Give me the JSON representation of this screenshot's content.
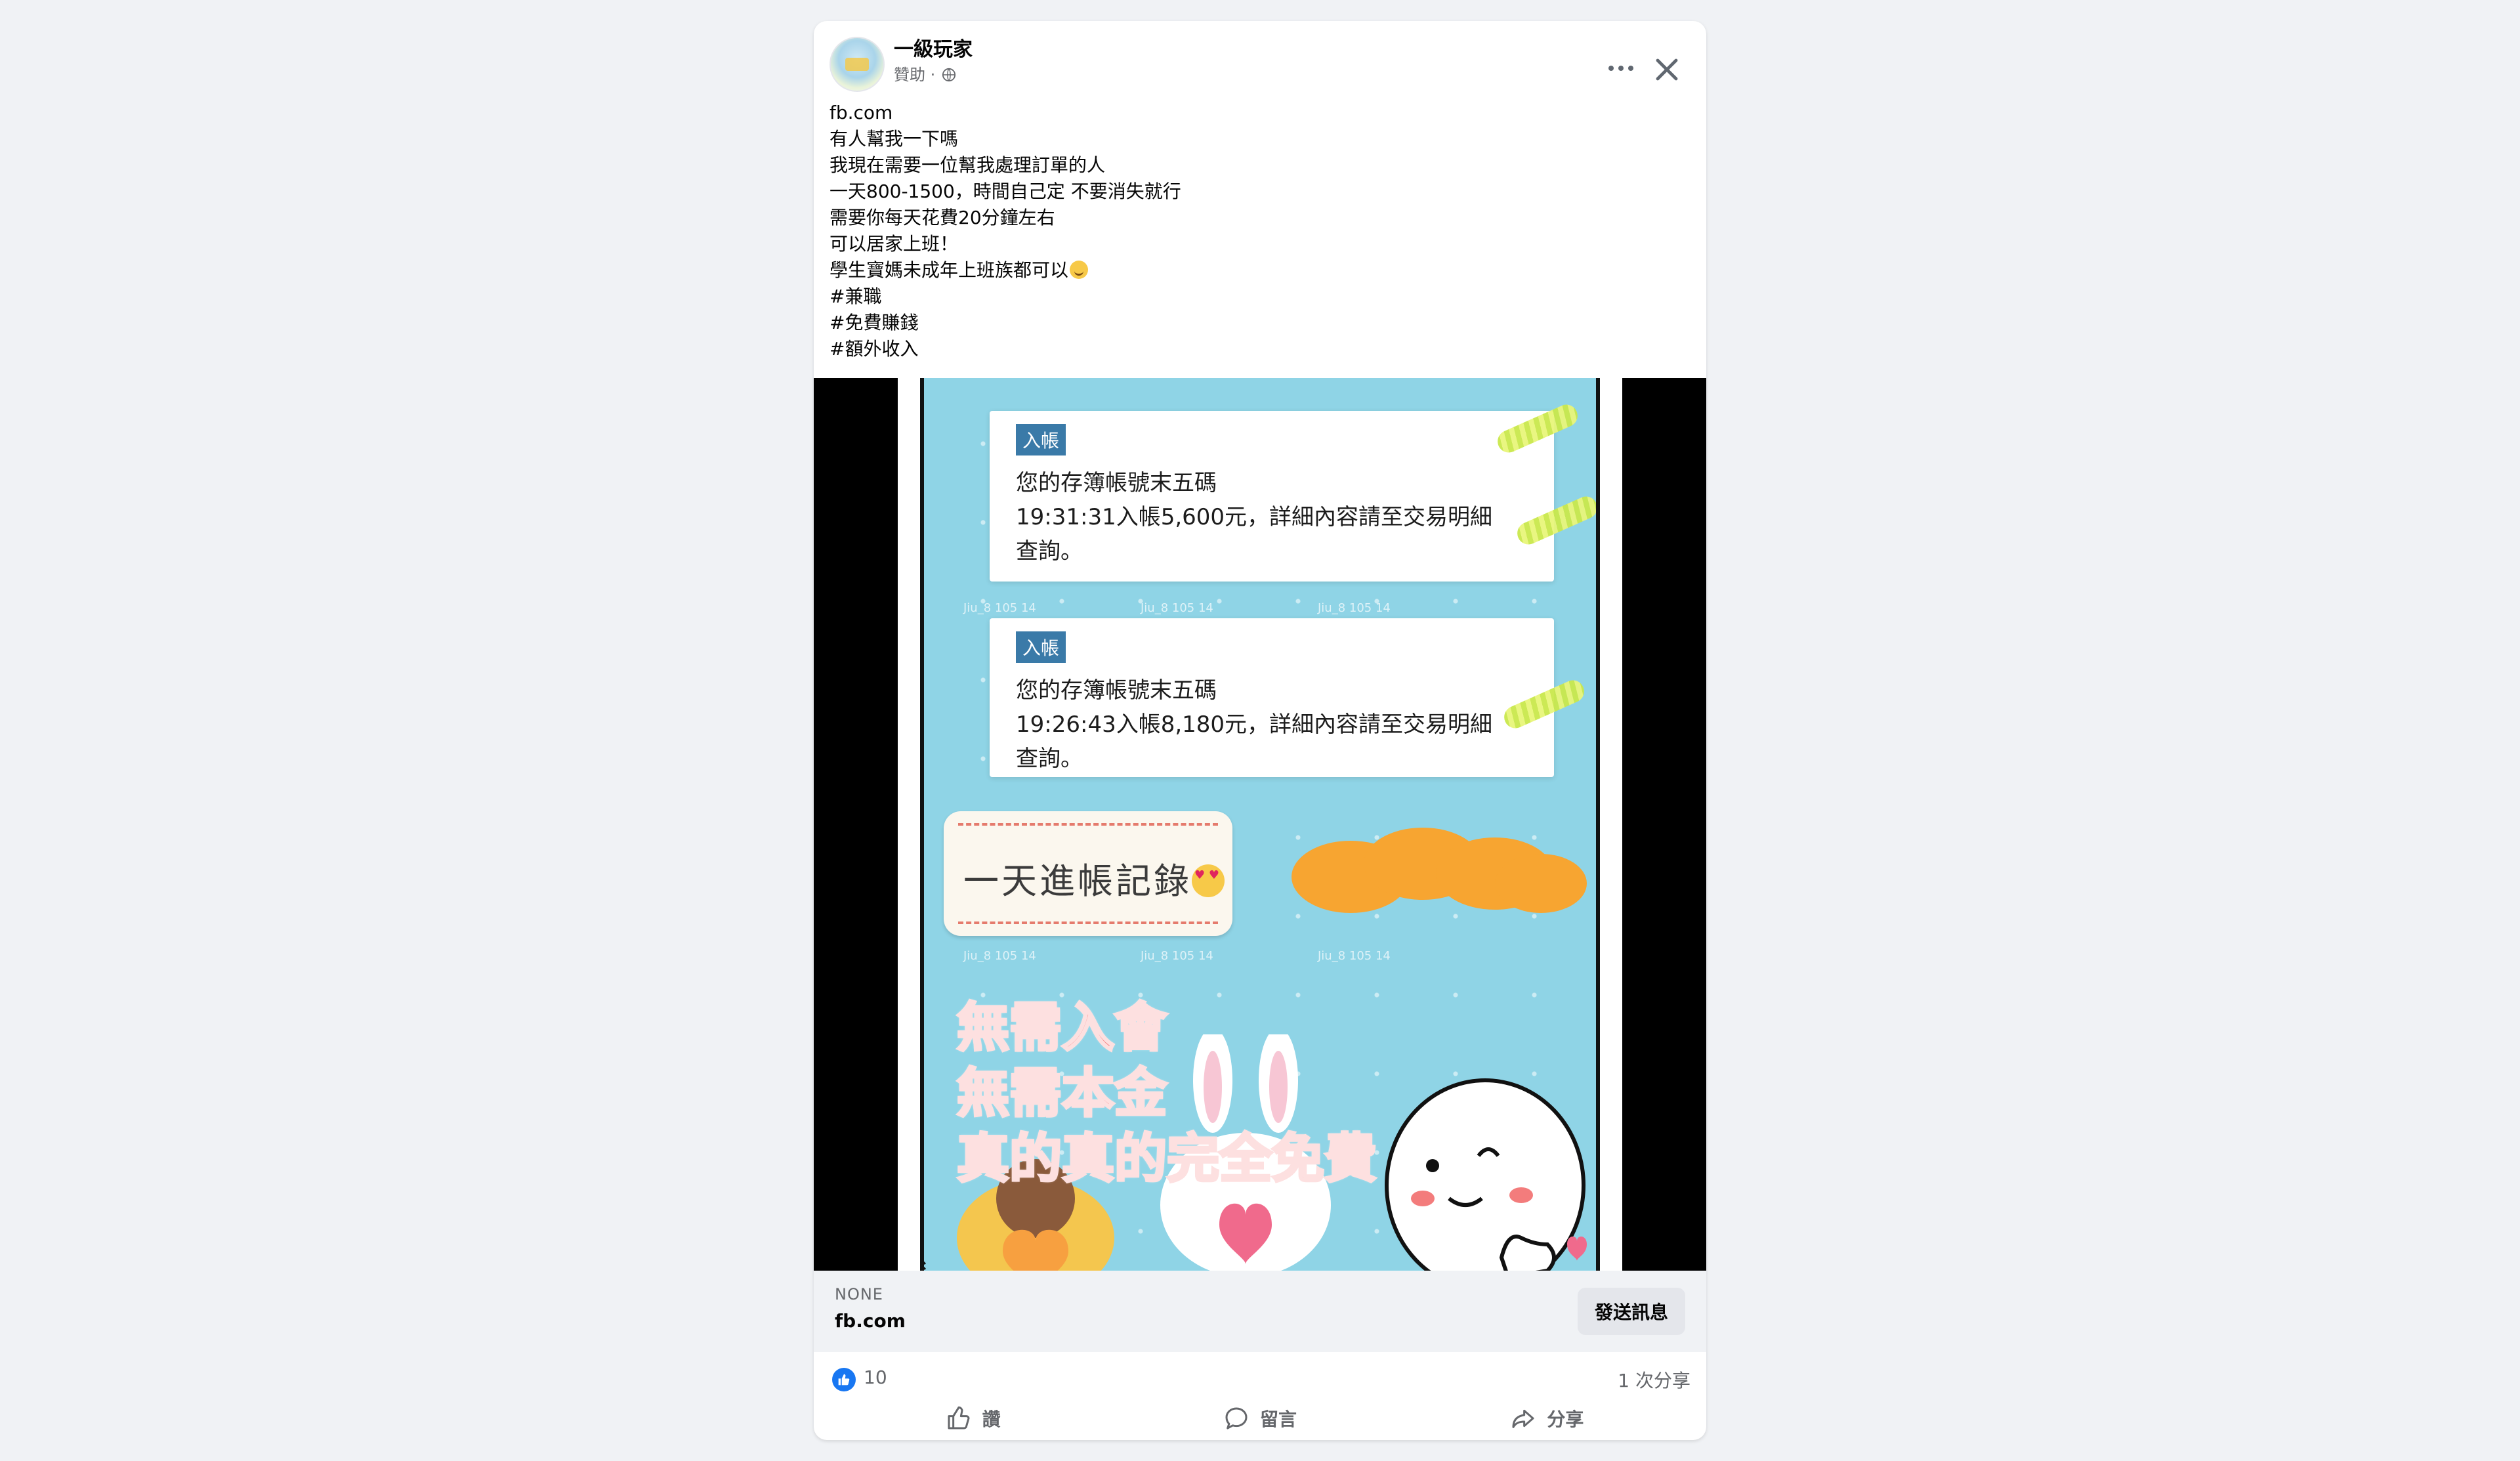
{
  "post": {
    "page_name": "一級玩家",
    "sponsored_label": "贊助 ·",
    "text_lines": [
      "fb.com",
      "有人幫我一下嗎",
      "我現在需要一位幫我處理訂單的人",
      "一天800-1500，時間自己定 不要消失就行",
      "需要你每天花費20分鐘左右",
      "可以居家上班！",
      "學生寶媽未成年上班族都可以",
      "#兼職",
      "#免費賺錢",
      "#額外收入"
    ]
  },
  "image": {
    "notice1": {
      "tag": "入帳",
      "line1": "您的存簿帳號末五碼",
      "line2": "19:31:31入帳5,600元，詳細內容請至交易明細",
      "line3": "查詢。"
    },
    "notice2": {
      "tag": "入帳",
      "line1": "您的存簿帳號末五碼",
      "line2": "19:26:43入帳8,180元，詳細內容請至交易明細",
      "line3": "查詢。"
    },
    "record_label": "一天進帳記錄",
    "promo_lines": [
      "無需入會",
      "無需本金",
      "真的真的完全免費"
    ]
  },
  "link": {
    "caption": "NONE",
    "domain": "fb.com",
    "send_label": "發送訊息"
  },
  "stats": {
    "likes": "10",
    "shares": "1 次分享"
  },
  "actions": {
    "like": "讚",
    "comment": "留言",
    "share": "分享"
  },
  "colors": {
    "accent": "#1877f2",
    "screen_bg": "#8fd4e6",
    "promo_text": "#f26a6a"
  },
  "icons": [
    "globe-icon",
    "more-icon",
    "close-icon",
    "like-icon",
    "comment-icon",
    "share-icon",
    "smile-emoji-icon",
    "heart-eyes-emoji-icon"
  ]
}
